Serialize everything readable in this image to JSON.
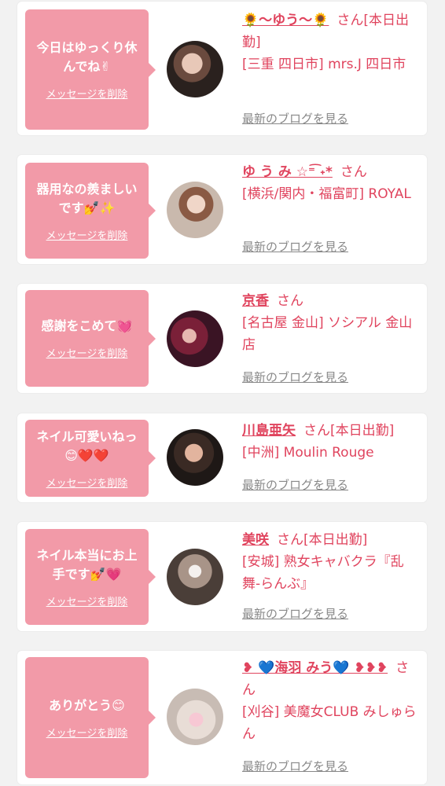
{
  "colors": {
    "bubble": "#f29aa8",
    "accent": "#e0445e",
    "blog_link": "#888888",
    "card": "#ffffff",
    "background": "#f2f2f2"
  },
  "blog_link_label": "最新のブログを見る",
  "delete_label": "メッセージを削除",
  "cards": [
    {
      "message": "今日はゆっくり休んでね✌",
      "name": "🌻〜ゆう〜🌻",
      "san": "さん[本日出勤]",
      "shop": "[三重 四日市] mrs.J 四日市",
      "avatar_icon": "avatar-photo"
    },
    {
      "message": "器用なの羨ましいです💅✨",
      "name": "ゆ う み ☆⁼͡   ˖*",
      "san": "さん",
      "shop": "[横浜/関内・福富町] ROYAL",
      "avatar_icon": "avatar-photo"
    },
    {
      "message": "感謝をこめて💓",
      "name": "京香",
      "san": "さん",
      "shop": "[名古屋 金山] ソシアル 金山店",
      "avatar_icon": "avatar-photo"
    },
    {
      "message": "ネイル可愛いねっ😊❤️❤️",
      "name": "川島亜矢",
      "san": "さん[本日出勤]",
      "shop": "[中洲] Moulin Rouge",
      "avatar_icon": "avatar-photo"
    },
    {
      "message": "ネイル本当にお上手です💅💗",
      "name": "美咲",
      "san": "さん[本日出勤]",
      "shop": "[安城] 熟女キャバクラ『乱舞-らんぶ』",
      "avatar_icon": "avatar-photo"
    },
    {
      "message": "ありがとう😊",
      "name": "❥ 💙海羽 みう💙 ❥❥❥",
      "san": "さん",
      "shop": "[刈谷] 美魔女CLUB みしゅらん",
      "avatar_icon": "avatar-photo"
    }
  ]
}
